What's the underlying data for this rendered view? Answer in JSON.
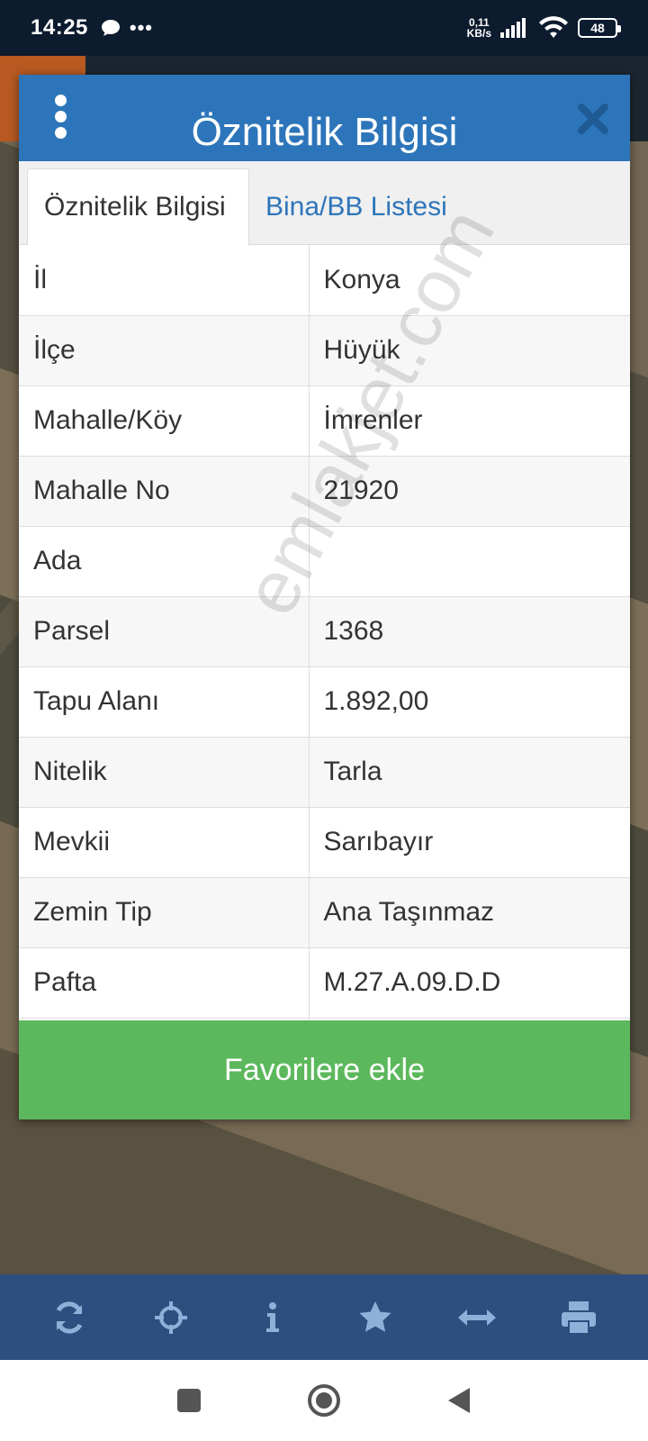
{
  "status_bar": {
    "time": "14:25",
    "dots": "•••",
    "net_speed_value": "0,11",
    "net_speed_unit": "KB/s",
    "battery": "48"
  },
  "dialog": {
    "title": "Öznitelik Bilgisi",
    "tabs": [
      {
        "label": "Öznitelik Bilgisi",
        "active": true
      },
      {
        "label": "Bina/BB Listesi",
        "active": false
      }
    ],
    "rows": [
      {
        "key": "İl",
        "value": "Konya"
      },
      {
        "key": "İlçe",
        "value": "Hüyük"
      },
      {
        "key": "Mahalle/Köy",
        "value": "İmrenler"
      },
      {
        "key": "Mahalle No",
        "value": "21920"
      },
      {
        "key": "Ada",
        "value": ""
      },
      {
        "key": "Parsel",
        "value": "1368"
      },
      {
        "key": "Tapu Alanı",
        "value": "1.892,00"
      },
      {
        "key": "Nitelik",
        "value": "Tarla"
      },
      {
        "key": "Mevkii",
        "value": "Sarıbayır"
      },
      {
        "key": "Zemin Tip",
        "value": "Ana Taşınmaz"
      },
      {
        "key": "Pafta",
        "value": "M.27.A.09.D.D"
      }
    ],
    "favorite_button": "Favorilere ekle"
  },
  "watermark": "emlakjet.com",
  "toolbar": {
    "icons": [
      "refresh-icon",
      "crosshair-icon",
      "info-icon",
      "star-icon",
      "measure-arrows-icon",
      "print-icon"
    ]
  },
  "colors": {
    "header_blue": "#2d75ba",
    "toolbar_blue": "#2d4e7e",
    "button_green": "#5cb85c"
  }
}
